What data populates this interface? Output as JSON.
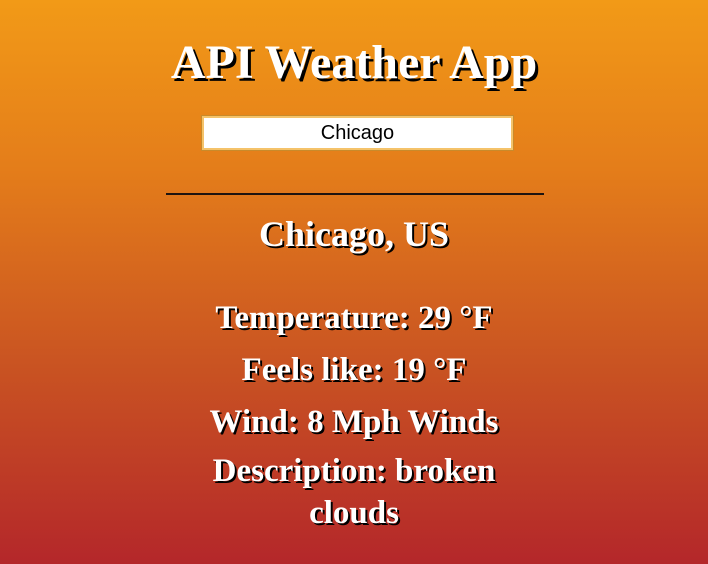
{
  "app": {
    "title": "API Weather App"
  },
  "search": {
    "value": "Chicago",
    "placeholder": ""
  },
  "weather": {
    "location": "Chicago, US",
    "temperature": "Temperature: 29 °F",
    "feels_like": "Feels like: 19 °F",
    "wind": "Wind: 8 Mph Winds",
    "description": "Description: broken clouds"
  },
  "colors": {
    "gradient_top": "#f29a17",
    "gradient_bottom": "#b4272a",
    "text": "#ffffff",
    "text_shadow": "#000000"
  }
}
